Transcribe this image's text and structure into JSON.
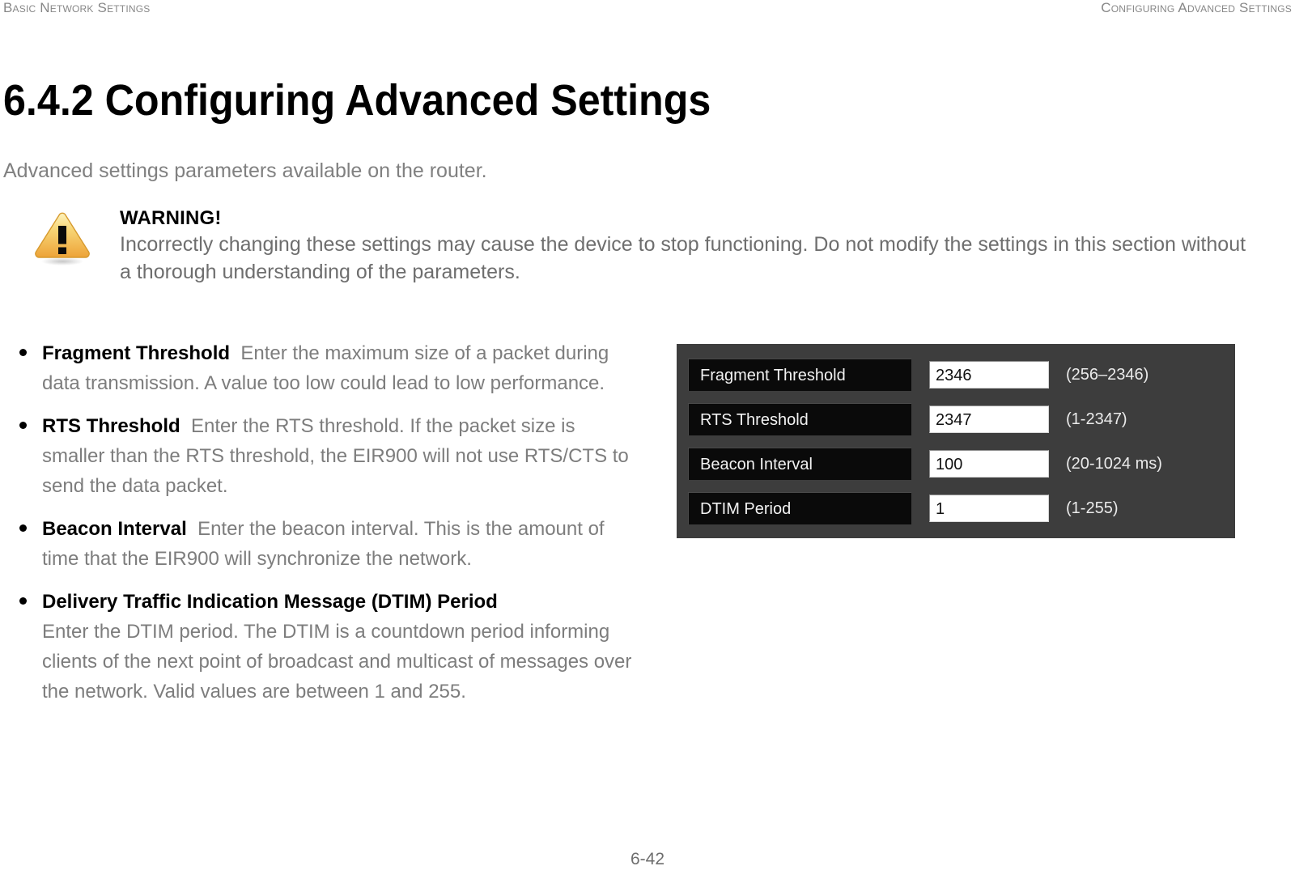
{
  "running_header": {
    "left": "Basic Network Settings",
    "right": "Configuring Advanced Settings"
  },
  "page_title": "6.4.2 Configuring Advanced Settings",
  "intro": "Advanced settings parameters available on the router.",
  "warning": {
    "icon": "warning-triangle-icon",
    "title": "WARNING!",
    "body": "Incorrectly changing these settings may cause the device to stop functioning. Do not modify the settings in this section without a thorough understanding of the parameters."
  },
  "bullets": [
    {
      "label": "Fragment Threshold",
      "text": "Enter the maximum size of a packet during data transmission. A value too low could lead to low performance.",
      "label_own_line": false
    },
    {
      "label": "RTS Threshold",
      "text": "Enter the RTS threshold.  If the packet size is smaller than the RTS threshold, the EIR900 will not use RTS/CTS to send the data packet.",
      "label_own_line": false
    },
    {
      "label": "Beacon Interval",
      "text": "Enter the beacon interval. This is the amount of time that the EIR900 will synchronize the network.",
      "label_own_line": false
    },
    {
      "label": "Delivery Traffic Indication Message (DTIM) Period",
      "text": "Enter the DTIM period. The DTIM is a countdown period informing clients of the next point of broadcast and multicast of messages over the network. Valid values are between 1 and 255.",
      "label_own_line": true
    }
  ],
  "screenshot": {
    "panel_bg": "#3d3d3d",
    "label_bg": "#0a0a0a",
    "rows": [
      {
        "label": "Fragment Threshold",
        "value": "2346",
        "hint": "(256–2346)"
      },
      {
        "label": "RTS Threshold",
        "value": "2347",
        "hint": "(1-2347)"
      },
      {
        "label": "Beacon Interval",
        "value": "100",
        "hint": "(20-1024 ms)"
      },
      {
        "label": "DTIM Period",
        "value": "1",
        "hint": "(1-255)"
      }
    ]
  },
  "footer": {
    "page_number": "6-42"
  }
}
